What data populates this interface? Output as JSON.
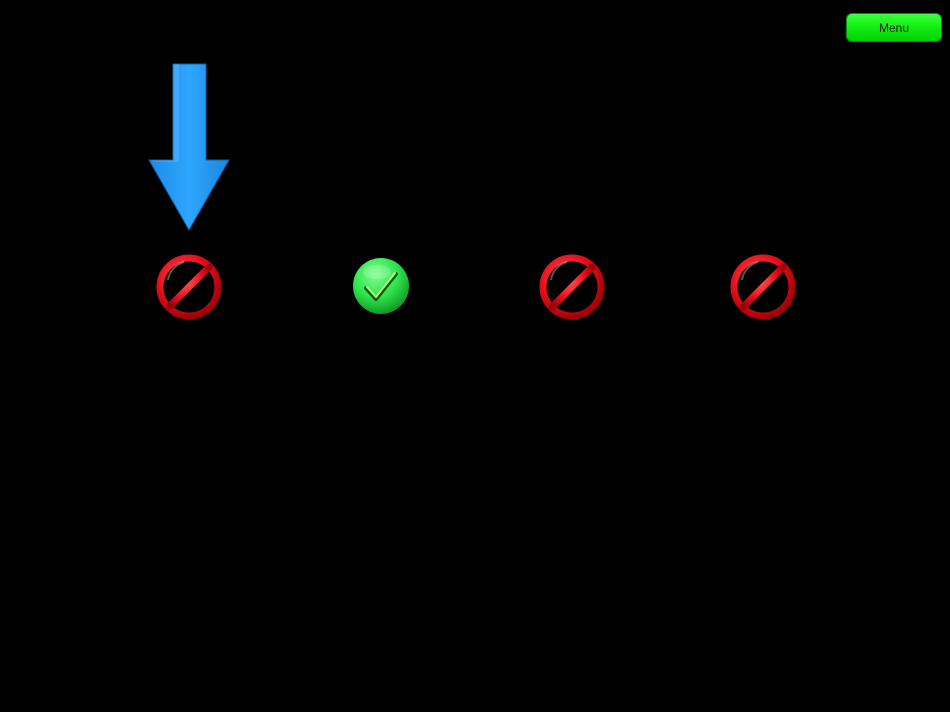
{
  "menu": {
    "label": "Menu"
  },
  "pointer": {
    "icon": "down-arrow-icon",
    "color": "#1e9bf5",
    "target_slot": 1
  },
  "slots": [
    {
      "index": 1,
      "state": "blocked",
      "icon": "no-entry-icon"
    },
    {
      "index": 2,
      "state": "correct",
      "icon": "check-circle-icon"
    },
    {
      "index": 3,
      "state": "blocked",
      "icon": "no-entry-icon"
    },
    {
      "index": 4,
      "state": "blocked",
      "icon": "no-entry-icon"
    }
  ],
  "colors": {
    "background": "#000000",
    "menu_green": "#14f014",
    "blocked_red": "#e8101a",
    "correct_green": "#2ee24a"
  }
}
